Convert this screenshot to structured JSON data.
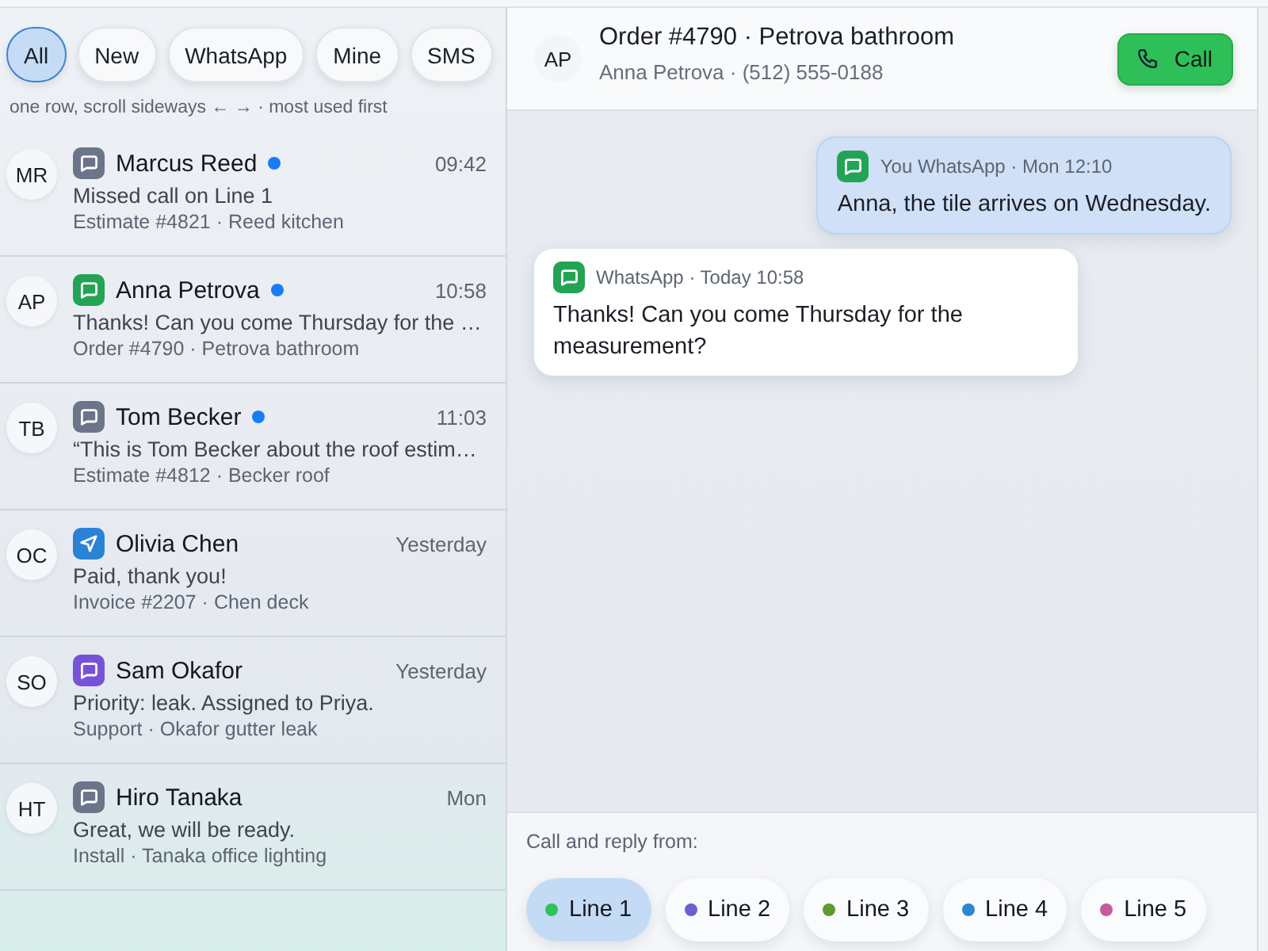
{
  "filters": [
    {
      "label": "All",
      "selected": true
    },
    {
      "label": "New",
      "selected": false
    },
    {
      "label": "WhatsApp",
      "selected": false
    },
    {
      "label": "Mine",
      "selected": false
    },
    {
      "label": "SMS",
      "selected": false
    }
  ],
  "filter_hint": "one row, scroll sideways ← → · most used first",
  "conversations": [
    {
      "initials": "MR",
      "channel": {
        "kind": "chat",
        "color": "#6b7489"
      },
      "name": "Marcus Reed",
      "unread": true,
      "time": "09:42",
      "preview": "Missed call on Line 1",
      "context": "Estimate #4821 · Reed kitchen"
    },
    {
      "initials": "AP",
      "channel": {
        "kind": "chat",
        "color": "#23a455"
      },
      "name": "Anna Petrova",
      "unread": true,
      "time": "10:58",
      "preview": "Thanks! Can you come Thursday for the …",
      "context": "Order #4790 · Petrova bathroom"
    },
    {
      "initials": "TB",
      "channel": {
        "kind": "chat",
        "color": "#6b7489"
      },
      "name": "Tom Becker",
      "unread": true,
      "time": "11:03",
      "preview": "“This is Tom Becker about the roof estim…",
      "context": "Estimate #4812 · Becker roof"
    },
    {
      "initials": "OC",
      "channel": {
        "kind": "send",
        "color": "#2b82d4"
      },
      "name": "Olivia Chen",
      "unread": false,
      "time": "Yesterday",
      "preview": "Paid, thank you!",
      "context": "Invoice #2207 · Chen deck"
    },
    {
      "initials": "SO",
      "channel": {
        "kind": "chat",
        "color": "#7752d8"
      },
      "name": "Sam Okafor",
      "unread": false,
      "time": "Yesterday",
      "preview": "Priority: leak. Assigned to Priya.",
      "context": "Support · Okafor gutter leak"
    },
    {
      "initials": "HT",
      "channel": {
        "kind": "chat",
        "color": "#6b7489"
      },
      "name": "Hiro Tanaka",
      "unread": false,
      "time": "Mon",
      "preview": "Great, we will be ready.",
      "context": "Install · Tanaka office lighting"
    }
  ],
  "header": {
    "initials": "AP",
    "title": "Order #4790 · Petrova bathroom",
    "subtitle": "Anna Petrova · (512) 555-0188",
    "call_button": "Call"
  },
  "messages": [
    {
      "kind": "outgoing",
      "channel": {
        "kind": "chat",
        "color": "#23a455"
      },
      "meta": "You WhatsApp · Mon 12:10",
      "text": "Anna, the tile arrives on Wednesday."
    },
    {
      "kind": "incoming",
      "channel": {
        "kind": "chat",
        "color": "#23a455"
      },
      "meta": "WhatsApp · Today 10:58",
      "text": "Thanks! Can you come Thursday for the measurement?"
    }
  ],
  "reply_from": {
    "label": "Call and reply from:",
    "lines": [
      {
        "label": "Line 1",
        "color": "#2fc25a",
        "selected": true
      },
      {
        "label": "Line 2",
        "color": "#6c5fd0",
        "selected": false
      },
      {
        "label": "Line 3",
        "color": "#5e9a2e",
        "selected": false
      },
      {
        "label": "Line 4",
        "color": "#2f86cf",
        "selected": false
      },
      {
        "label": "Line 5",
        "color": "#c45b9c",
        "selected": false
      }
    ]
  }
}
